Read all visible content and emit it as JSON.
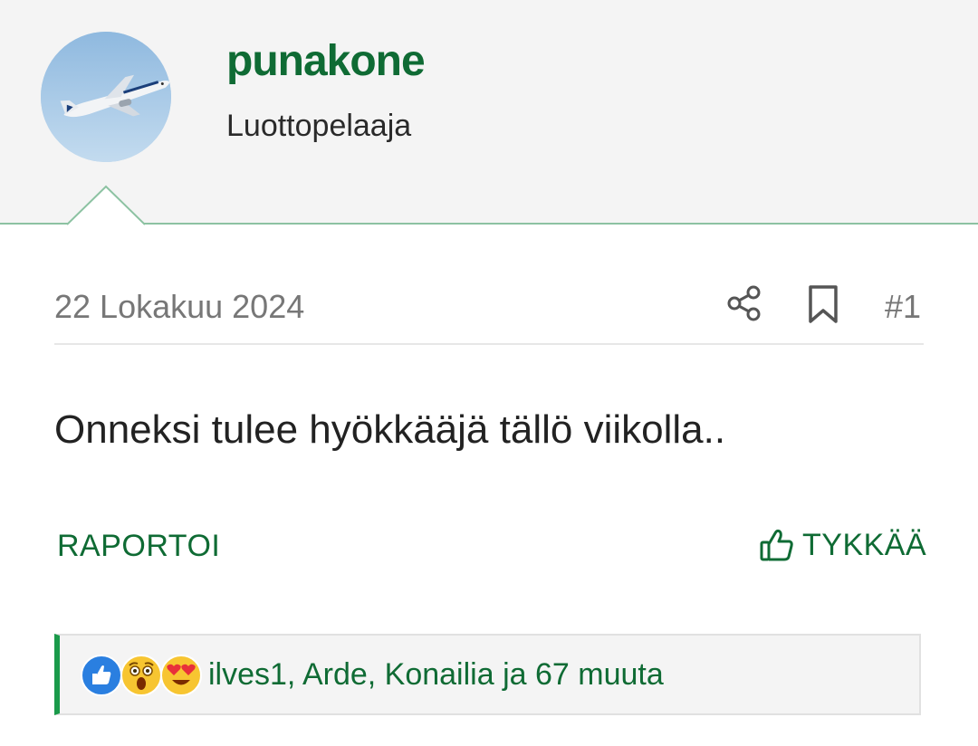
{
  "user": {
    "name": "punakone",
    "title": "Luottopelaaja"
  },
  "post": {
    "date": "22 Lokakuu 2024",
    "number": "#1",
    "body": "Onneksi tulee hyökkääjä tällö viikolla.."
  },
  "actions": {
    "report_label": "RAPORTOI",
    "like_label": "TYKKÄÄ"
  },
  "reactions": {
    "icons": [
      "like-reaction-icon",
      "wow-reaction-icon",
      "love-reaction-icon"
    ],
    "text": "ilves1, Arde, Konailia ja 67 muuta"
  },
  "colors": {
    "brand_green": "#0f6b34",
    "accent_green": "#1a9a4a",
    "header_background": "#f4f4f4"
  }
}
